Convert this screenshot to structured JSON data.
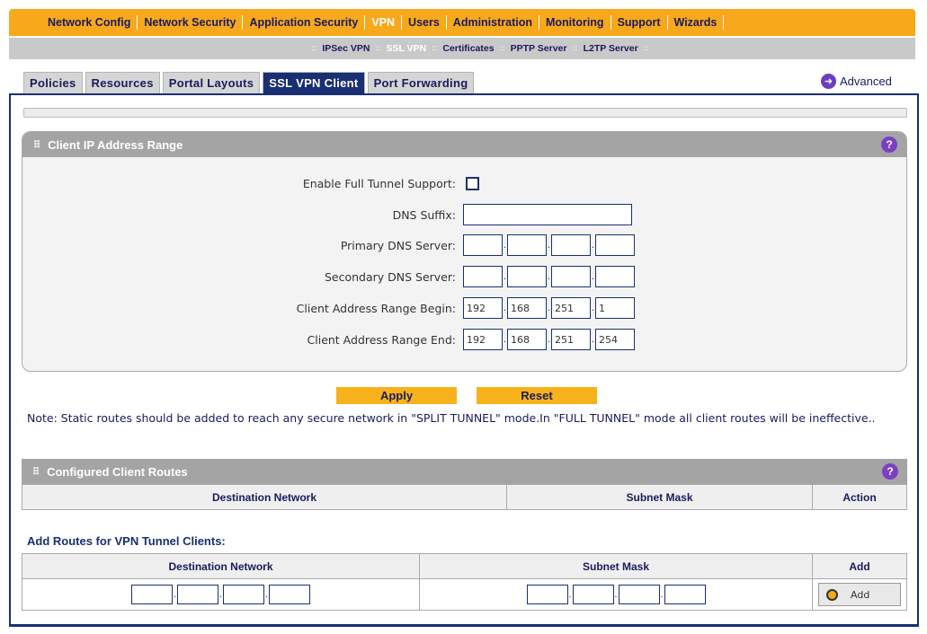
{
  "top_nav": [
    "Network Config",
    "Network Security",
    "Application Security",
    "VPN",
    "Users",
    "Administration",
    "Monitoring",
    "Support",
    "Wizards"
  ],
  "sub_nav": [
    "IPSec VPN",
    "SSL VPN",
    "Certificates",
    "PPTP Server",
    "L2TP Server"
  ],
  "tabs": [
    "Policies",
    "Resources",
    "Portal Layouts",
    "SSL VPN Client",
    "Port Forwarding"
  ],
  "advanced_label": "Advanced",
  "client_ip_section": {
    "title": "Client IP Address Range",
    "enable_full_tunnel_label": "Enable Full Tunnel Support:",
    "dns_suffix_label": "DNS Suffix:",
    "primary_dns_label": "Primary DNS Server:",
    "secondary_dns_label": "Secondary DNS Server:",
    "range_begin_label": "Client Address Range Begin:",
    "range_end_label": "Client Address Range End:",
    "range_begin": [
      "192",
      "168",
      "251",
      "1"
    ],
    "range_end": [
      "192",
      "168",
      "251",
      "254"
    ]
  },
  "buttons": {
    "apply": "Apply",
    "reset": "Reset",
    "add": "Add"
  },
  "note": "Note: Static routes should be added to reach any secure network in \"SPLIT TUNNEL\" mode.In \"FULL TUNNEL\" mode all client routes will be ineffective..",
  "configured_routes": {
    "title": "Configured Client Routes",
    "columns": [
      "Destination Network",
      "Subnet Mask",
      "Action"
    ]
  },
  "add_routes": {
    "title": "Add Routes for VPN Tunnel Clients:",
    "columns": [
      "Destination Network",
      "Subnet Mask",
      "Add"
    ]
  },
  "colors": {
    "accent_orange": "#f7a81b",
    "navy": "#1a2f73",
    "section_gray": "#a4a4a4"
  }
}
